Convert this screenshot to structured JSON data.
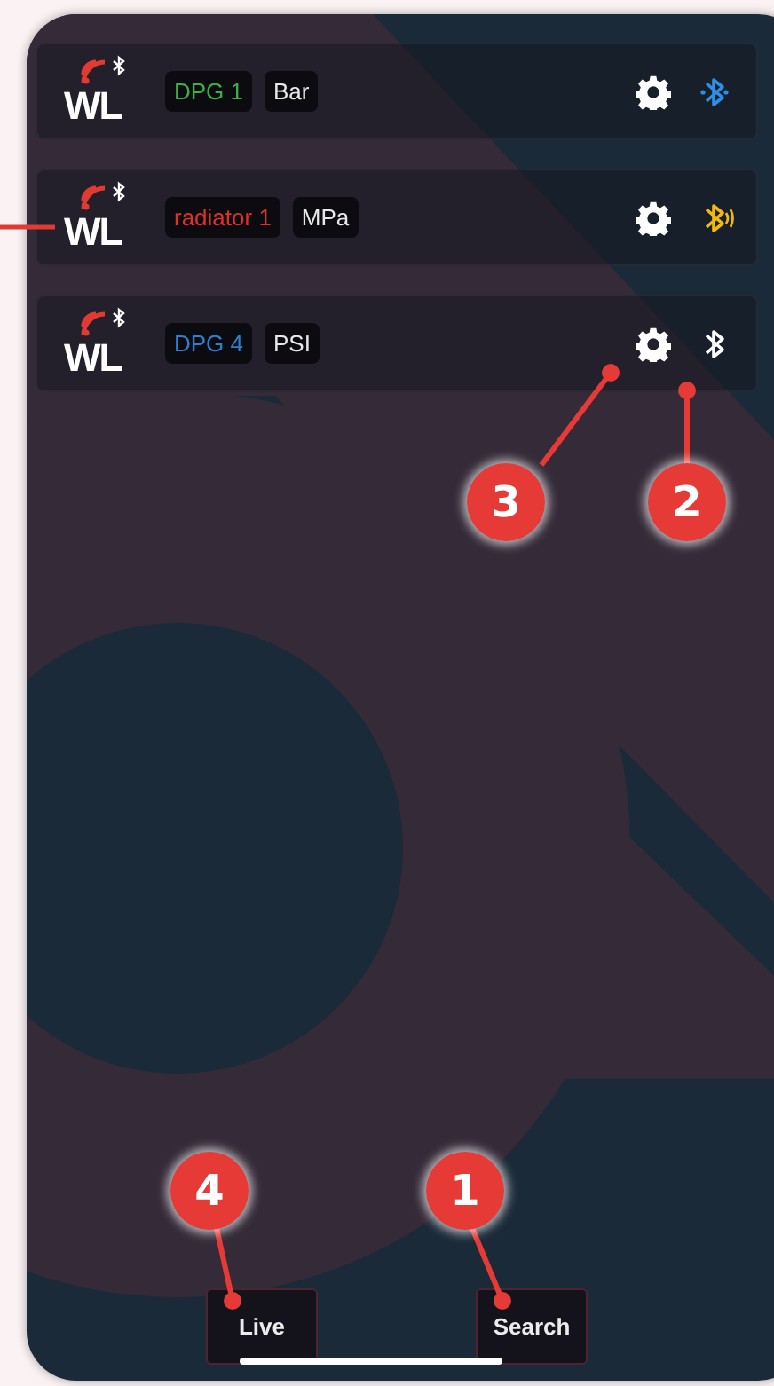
{
  "devices": [
    {
      "logo_text": "WL",
      "name": "DPG 1",
      "color": "#3fae49",
      "unit": "Bar",
      "bluetooth": {
        "kind": "connected",
        "color": "#2e8fe6"
      }
    },
    {
      "logo_text": "WL",
      "name": "radiator 1",
      "color": "#e0302c",
      "unit": "MPa",
      "bluetooth": {
        "kind": "signal",
        "color": "#f0b90b"
      }
    },
    {
      "logo_text": "WL",
      "name": "DPG 4",
      "color": "#2f7fd0",
      "unit": "PSI",
      "bluetooth": {
        "kind": "idle",
        "color": "#ffffff"
      }
    }
  ],
  "buttons": [
    {
      "label": "Live"
    },
    {
      "label": "Search"
    }
  ],
  "callouts": [
    {
      "number": "3"
    },
    {
      "number": "2"
    },
    {
      "number": "4"
    },
    {
      "number": "1"
    }
  ]
}
